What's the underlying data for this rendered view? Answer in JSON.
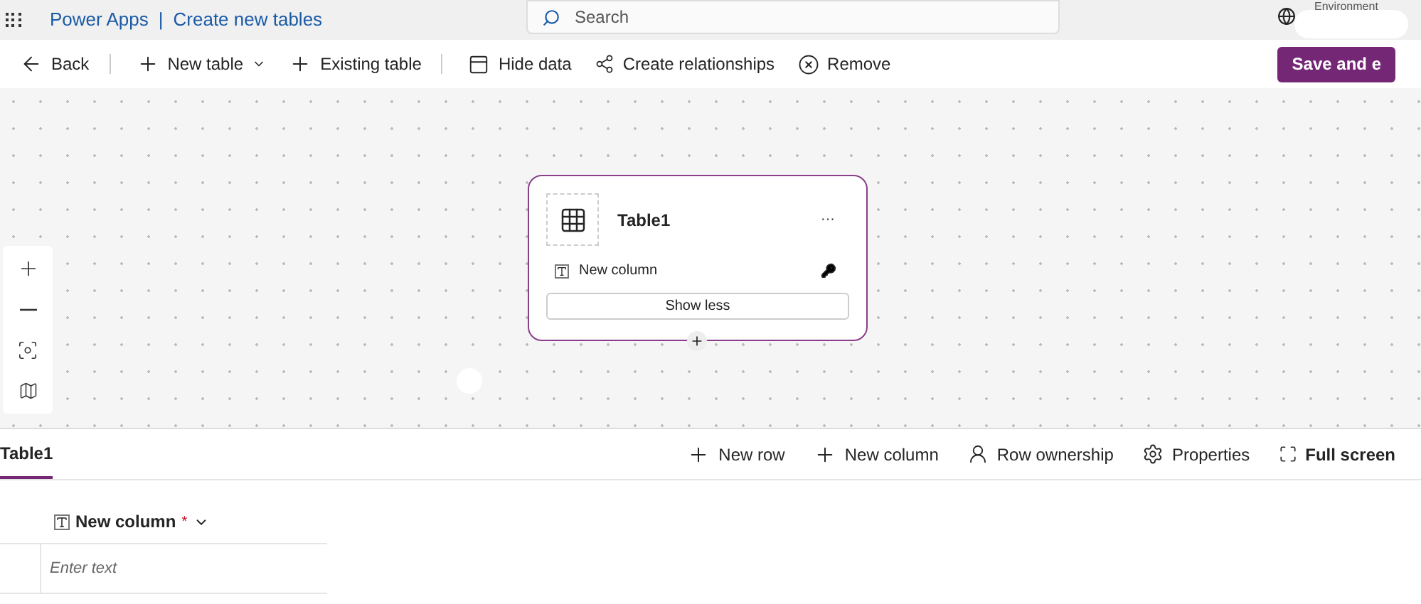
{
  "header": {
    "app_name": "Power Apps",
    "separator": "|",
    "page_title": "Create new tables",
    "search": {
      "placeholder": "Search"
    },
    "environment_label": "Environment"
  },
  "toolbar": {
    "items": [
      {
        "kind": "back",
        "label": "Back"
      },
      {
        "kind": "dropdown",
        "label": "New table"
      },
      {
        "kind": "add",
        "label": "Existing table"
      },
      {
        "kind": "hide",
        "label": "Hide data"
      },
      {
        "kind": "relate",
        "label": "Create relationships"
      },
      {
        "kind": "remove",
        "label": "Remove"
      }
    ],
    "primary_button": "Save and e"
  },
  "table_card": {
    "title": "Table1",
    "more": "···",
    "columns": [
      {
        "name": "New column",
        "primary_key": true
      }
    ],
    "toggle_button": "Show less"
  },
  "zoom_controls": [
    {
      "kind": "zoom-in"
    },
    {
      "kind": "zoom-out"
    },
    {
      "kind": "fit"
    },
    {
      "kind": "map"
    }
  ],
  "bottom_panel": {
    "tabs": [
      {
        "label": "Table1",
        "selected": true
      }
    ],
    "actions": [
      {
        "kind": "add",
        "label": "New row"
      },
      {
        "kind": "add",
        "label": "New column"
      },
      {
        "kind": "owner",
        "label": "Row ownership"
      },
      {
        "kind": "gear",
        "label": "Properties"
      },
      {
        "kind": "full",
        "label": "Full screen"
      }
    ],
    "grid": {
      "column": {
        "name": "New column",
        "required_mark": "*"
      },
      "cell_placeholder": "Enter text"
    }
  }
}
